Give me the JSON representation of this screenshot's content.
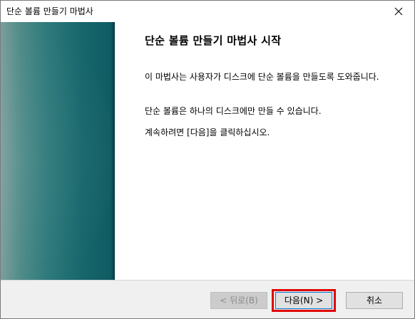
{
  "window": {
    "title": "단순 볼륨 만들기 마법사"
  },
  "content": {
    "heading": "단순 볼륨 만들기 마법사 시작",
    "paragraph1": "이 마법사는 사용자가 디스크에 단순 볼륨을 만들도록 도와줍니다.",
    "paragraph2": "단순 볼륨은 하나의 디스크에만 만들 수 있습니다.",
    "paragraph3": "계속하려면 [다음]을 클릭하십시오."
  },
  "buttons": {
    "back_label": "< 뒤로(B)",
    "next_label": "다음(N) >",
    "cancel_label": "취소"
  },
  "icons": {
    "close": "close-icon"
  },
  "colors": {
    "highlight": "#e00000",
    "panel_teal": "#17676d"
  }
}
